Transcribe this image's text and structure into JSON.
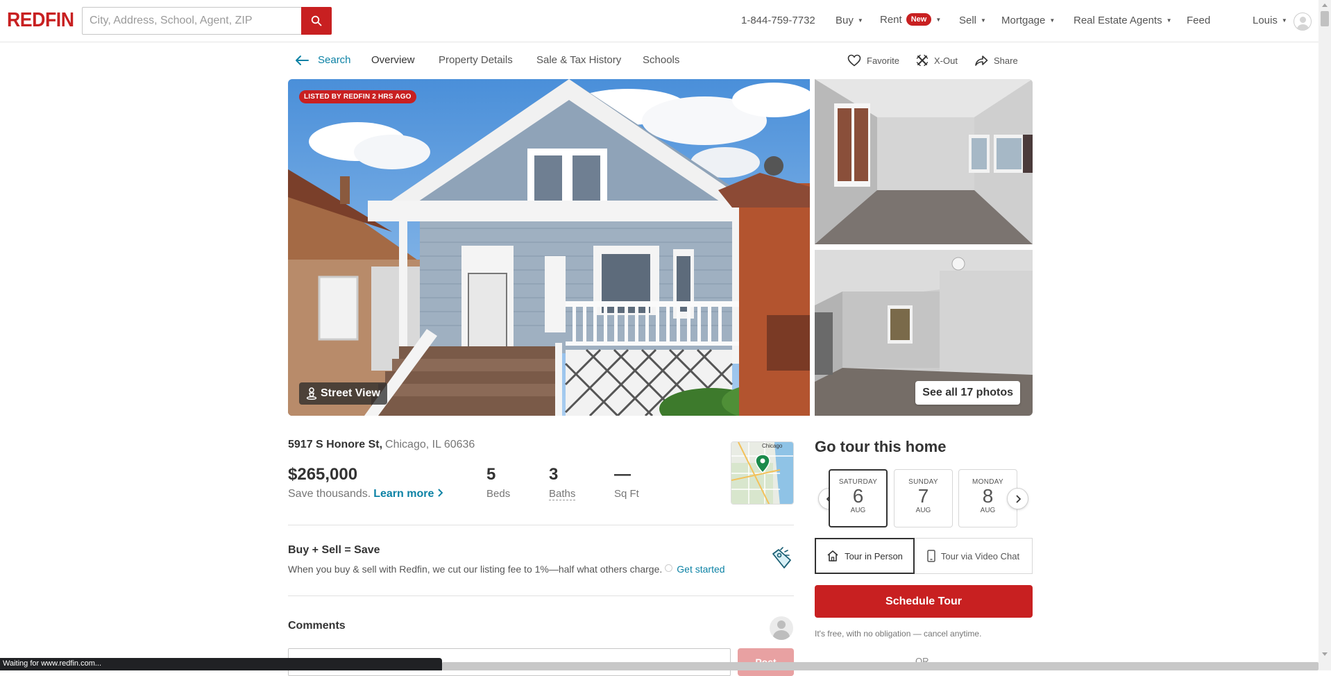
{
  "header": {
    "logo": "REDFIN",
    "search_placeholder": "City, Address, School, Agent, ZIP",
    "phone": "1-844-759-7732",
    "nav": {
      "buy": "Buy",
      "rent": "Rent",
      "rent_badge": "New",
      "sell": "Sell",
      "mortgage": "Mortgage",
      "agents": "Real Estate Agents",
      "feed": "Feed",
      "user": "Louis"
    }
  },
  "subnav": {
    "back": "Search",
    "tabs": [
      "Overview",
      "Property Details",
      "Sale & Tax History",
      "Schools"
    ],
    "actions": {
      "favorite": "Favorite",
      "xout": "X-Out",
      "share": "Share"
    }
  },
  "photos": {
    "badge": "LISTED BY REDFIN 2 HRS AGO",
    "street_view": "Street View",
    "see_all": "See all 17 photos"
  },
  "listing": {
    "street": "5917 S Honore St,",
    "city": "Chicago, IL 60636",
    "price": "$265,000",
    "save_text": "Save thousands.",
    "learn_more": "Learn more",
    "beds_value": "5",
    "beds_label": "Beds",
    "baths_value": "3",
    "baths_label": "Baths",
    "sqft_value": "—",
    "sqft_label": "Sq Ft",
    "map_label": "Chicago"
  },
  "promo": {
    "title": "Buy + Sell = Save",
    "text": "When you buy & sell with Redfin, we cut our listing fee to 1%—half what others charge.",
    "link": "Get started"
  },
  "comments": {
    "title": "Comments",
    "post_label": "Post"
  },
  "tour": {
    "title": "Go tour this home",
    "dates": [
      {
        "dow": "SATURDAY",
        "day": "6",
        "mon": "AUG"
      },
      {
        "dow": "SUNDAY",
        "day": "7",
        "mon": "AUG"
      },
      {
        "dow": "MONDAY",
        "day": "8",
        "mon": "AUG"
      }
    ],
    "in_person": "Tour in Person",
    "video_chat": "Tour via Video Chat",
    "schedule": "Schedule Tour",
    "free_text": "It's free, with no obligation — cancel anytime.",
    "or": "OR"
  },
  "status": {
    "text": "Waiting for www.redfin.com..."
  },
  "colors": {
    "brand_red": "#c82021",
    "link_blue": "#0c82a5"
  }
}
